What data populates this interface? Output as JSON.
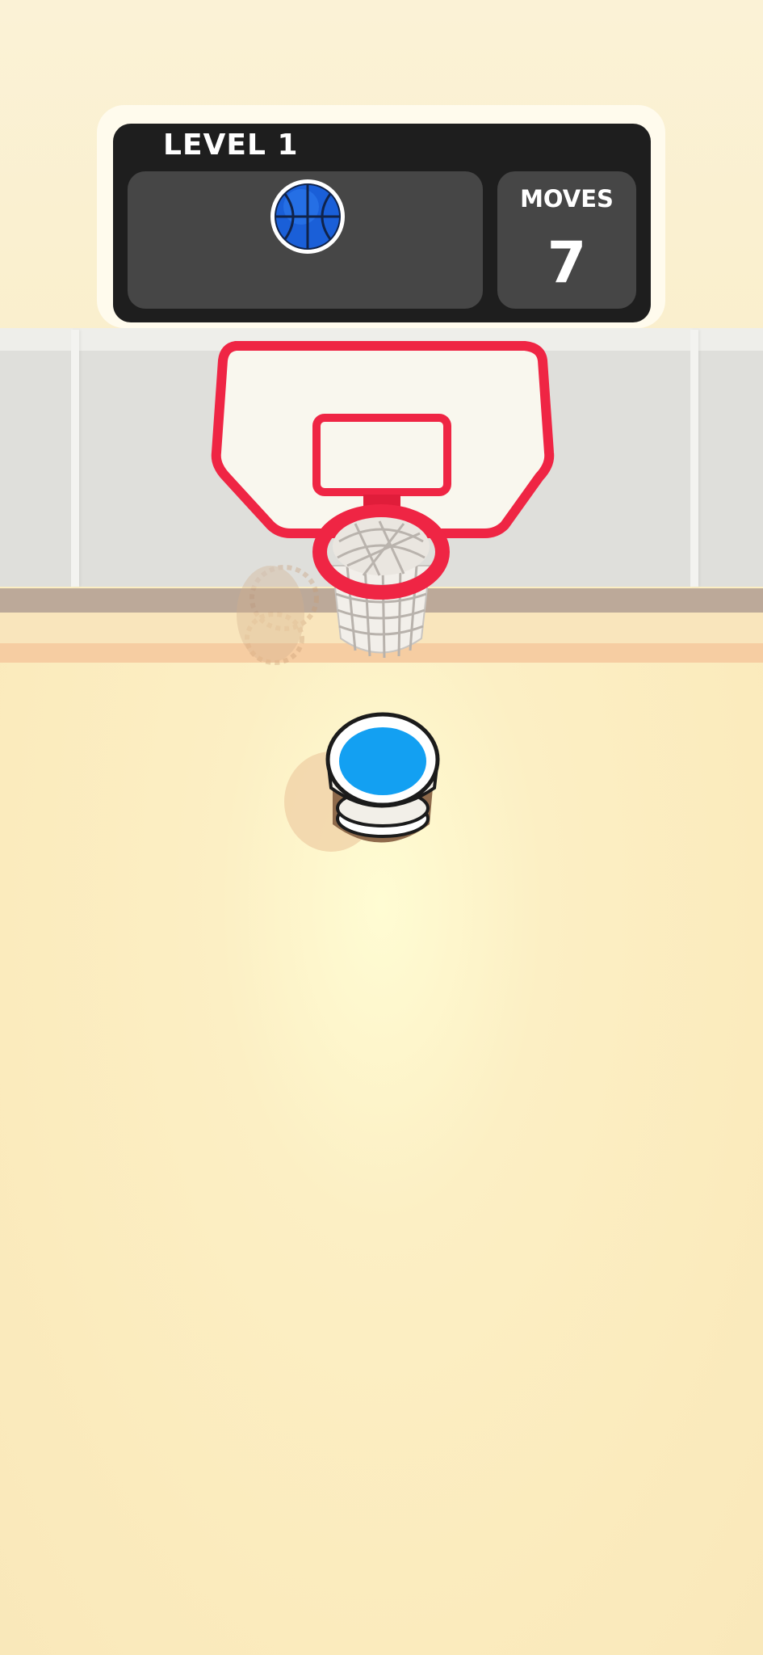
{
  "scoreboard": {
    "level_label": "LEVEL 1",
    "moves_label": "MOVES",
    "moves_value": "7",
    "target_ball_icon": "basketball-icon"
  },
  "scene": {
    "objects": [
      "basketball-hoop",
      "ball-launcher"
    ],
    "colors": {
      "ball": "#1565e0",
      "rim": "#f2203f",
      "launcher_top": "#13a0f2",
      "floor": "#fbeec3",
      "scoreboard": "#1e1e1e"
    }
  }
}
